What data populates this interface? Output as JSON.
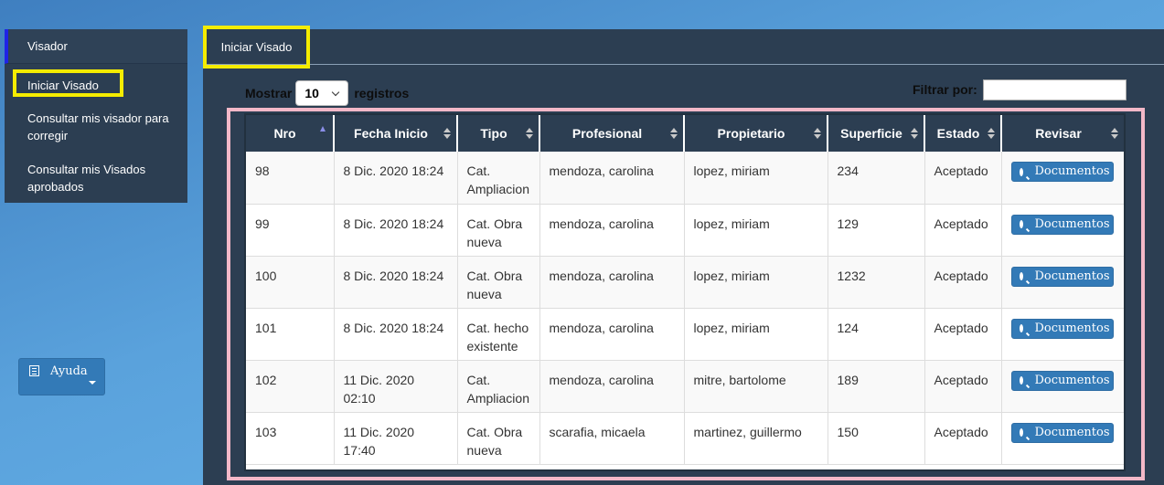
{
  "sidebar": {
    "items": [
      {
        "label": "Visador"
      },
      {
        "label": "Iniciar Visado"
      },
      {
        "label": "Consultar mis visador para corregir"
      },
      {
        "label": "Consultar mis Visados aprobados"
      }
    ],
    "help_label": "Ayuda"
  },
  "tab": {
    "label": "Iniciar Visado"
  },
  "controls": {
    "show_label": "Mostrar",
    "page_size": "10",
    "records_label": "registros",
    "filter_label": "Filtrar por:",
    "filter_value": ""
  },
  "table": {
    "headers": [
      "Nro",
      "Fecha Inicio",
      "Tipo",
      "Profesional",
      "Propietario",
      "Superficie",
      "Estado",
      "Revisar"
    ],
    "rows": [
      {
        "nro": "98",
        "fecha": "8 Dic. 2020 18:24",
        "tipo": "Cat. Ampliacion",
        "profesional": "mendoza, carolina",
        "propietario": "lopez, miriam",
        "superficie": "234",
        "estado": "Aceptado",
        "accion": "Documentos"
      },
      {
        "nro": "99",
        "fecha": "8 Dic. 2020 18:24",
        "tipo": "Cat. Obra nueva",
        "profesional": "mendoza, carolina",
        "propietario": "lopez, miriam",
        "superficie": "129",
        "estado": "Aceptado",
        "accion": "Documentos"
      },
      {
        "nro": "100",
        "fecha": "8 Dic. 2020 18:24",
        "tipo": "Cat. Obra nueva",
        "profesional": "mendoza, carolina",
        "propietario": "lopez, miriam",
        "superficie": "1232",
        "estado": "Aceptado",
        "accion": "Documentos"
      },
      {
        "nro": "101",
        "fecha": "8 Dic. 2020 18:24",
        "tipo": "Cat. hecho existente",
        "profesional": "mendoza, carolina",
        "propietario": "lopez, miriam",
        "superficie": "124",
        "estado": "Aceptado",
        "accion": "Documentos"
      },
      {
        "nro": "102",
        "fecha": "11 Dic. 2020 02:10",
        "tipo": "Cat. Ampliacion",
        "profesional": "mendoza, carolina",
        "propietario": "mitre, bartolome",
        "superficie": "189",
        "estado": "Aceptado",
        "accion": "Documentos"
      },
      {
        "nro": "103",
        "fecha": "11 Dic. 2020 17:40",
        "tipo": "Cat. Obra nueva",
        "profesional": "scarafia, micaela",
        "propietario": "martinez, guillermo",
        "superficie": "150",
        "estado": "Aceptado",
        "accion": "Documentos"
      }
    ]
  },
  "colors": {
    "highlight": "#f5ec00",
    "table_outline": "#f3b8c8",
    "panel": "#2c3e52",
    "button": "#337ab7"
  }
}
